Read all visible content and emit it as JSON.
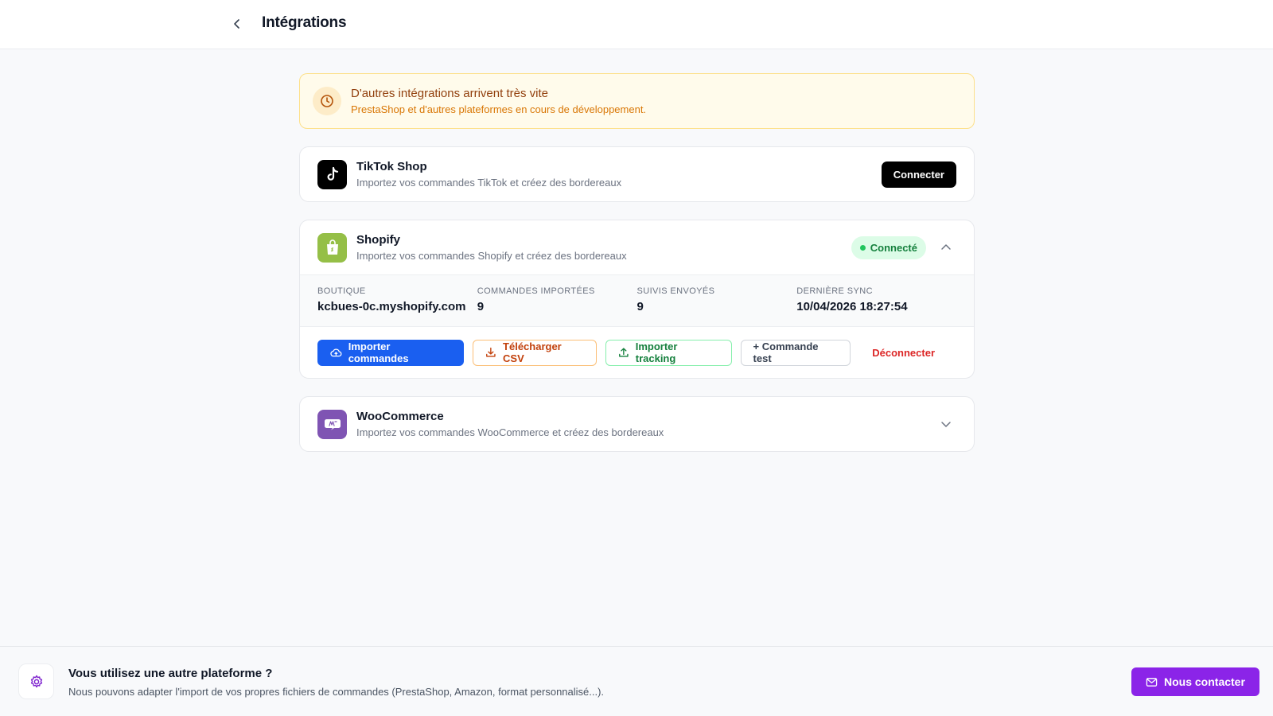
{
  "header": {
    "title": "Intégrations"
  },
  "notice": {
    "title": "D'autres intégrations arrivent très vite",
    "subtitle": "PrestaShop et d'autres plateformes en cours de développement."
  },
  "integrations": [
    {
      "name": "TikTok Shop",
      "description": "Importez vos commandes TikTok et créez des bordereaux",
      "action_label": "Connecter"
    },
    {
      "name": "Shopify",
      "description": "Importez vos commandes Shopify et créez des bordereaux",
      "status": "Connecté",
      "stats": [
        {
          "label": "BOUTIQUE",
          "value": "kcbues-0c.myshopify.com"
        },
        {
          "label": "COMMANDES IMPORTÉES",
          "value": "9"
        },
        {
          "label": "SUIVIS ENVOYÉS",
          "value": "9"
        },
        {
          "label": "DERNIÈRE SYNC",
          "value": "10/04/2026 18:27:54"
        }
      ],
      "actions": {
        "import_orders": "Importer commandes",
        "download_csv": "Télécharger CSV",
        "import_tracking": "Importer tracking",
        "test_order": "+ Commande test",
        "disconnect": "Déconnecter"
      }
    },
    {
      "name": "WooCommerce",
      "description": "Importez vos commandes WooCommerce et créez des bordereaux"
    }
  ],
  "footer": {
    "title": "Vous utilisez une autre plateforme ?",
    "description": "Nous pouvons adapter l'import de vos propres fichiers de commandes (PrestaShop, Amazon, format personnalisé...).",
    "contact_label": "Nous contacter"
  },
  "colors": {
    "primary": "#1a5ff0",
    "connected": "#15803d",
    "danger": "#dc2626",
    "contact": "#8b24e8",
    "shopify": "#95bf47",
    "woocommerce": "#7f54b3"
  },
  "icons": {
    "back": "chevron-left-icon",
    "notice": "clock-icon",
    "tiktok": "tiktok-logo-icon",
    "shopify": "shopify-bag-icon",
    "woocommerce": "woocommerce-logo-icon",
    "footer": "gear-icon",
    "contact": "mail-icon"
  }
}
